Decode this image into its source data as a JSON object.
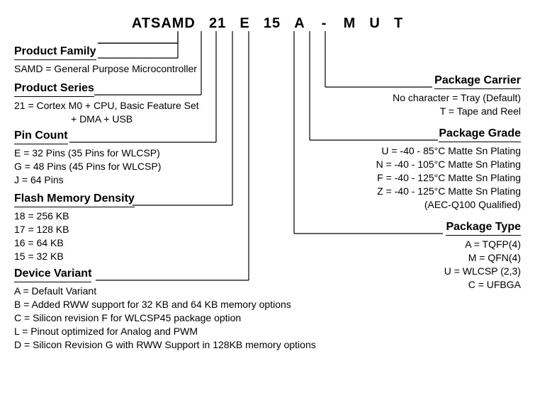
{
  "part": {
    "prefix": "ATSAMD",
    "series": "21",
    "pin": "E",
    "flash": "15",
    "variant": "A",
    "dash": "-",
    "ptype": "M",
    "grade": "U",
    "carrier": "T"
  },
  "left": {
    "family": {
      "title": "Product Family",
      "l1": "SAMD = General Purpose Microcontroller"
    },
    "series": {
      "title": "Product Series",
      "l1": "21 = Cortex M0 + CPU, Basic Feature Set",
      "l2": "+ DMA + USB"
    },
    "pin": {
      "title": "Pin Count",
      "l1": "E = 32 Pins (35 Pins for WLCSP)",
      "l2": "G = 48 Pins (45 Pins for WLCSP)",
      "l3": "J  = 64 Pins"
    },
    "flash": {
      "title": "Flash Memory Density",
      "l1": "18 = 256 KB",
      "l2": "17 = 128 KB",
      "l3": "16 = 64 KB",
      "l4": "15 = 32 KB"
    },
    "variant": {
      "title": "Device Variant",
      "l1": "A = Default Variant",
      "l2": "B = Added RWW support for 32 KB and 64 KB memory options",
      "l3": "C = Silicon revision F for WLCSP45 package option",
      "l4": "L  = Pinout optimized for Analog and PWM",
      "l5": "D = Silicon Revision G with RWW Support in 128KB memory options"
    }
  },
  "right": {
    "carrier": {
      "title": "Package Carrier",
      "l1": "No character = Tray (Default)",
      "l2": "T = Tape and Reel"
    },
    "grade": {
      "title": "Package Grade",
      "l1": "U =  -40 - 85°C Matte Sn Plating",
      "l2": "N =  -40 - 105°C Matte Sn Plating",
      "l3": "F =  -40 - 125°C Matte Sn Plating",
      "l4": "Z =  -40 - 125°C Matte Sn Plating",
      "l5": "(AEC-Q100 Qualified)"
    },
    "ptype": {
      "title": "Package Type",
      "l1": "A = TQFP(4)",
      "l2": "M = QFN(4)",
      "l3": "U = WLCSP (2,3)",
      "l4": "C = UFBGA"
    }
  }
}
